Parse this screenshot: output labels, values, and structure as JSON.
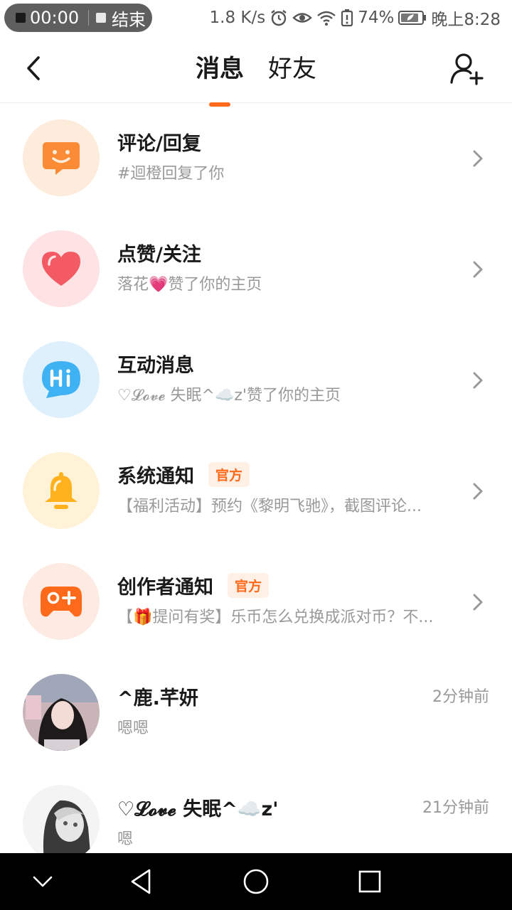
{
  "status_bar": {
    "record_time": "00:00",
    "record_stop_label": "结束",
    "net_speed": "1.8 K/s",
    "battery": "74%",
    "time": "晚上8:28"
  },
  "header": {
    "tabs": [
      {
        "label": "消息"
      },
      {
        "label": "好友"
      }
    ]
  },
  "notifications": [
    {
      "title": "评论/回复",
      "subtitle": "#迴橙回复了你",
      "icon": "smile-chat-icon",
      "bg": "#fdebdc",
      "fg": "#fb8c35"
    },
    {
      "title": "点赞/关注",
      "subtitle": "落花💗赞了你的主页",
      "icon": "heart-icon",
      "bg": "#fde3e3",
      "fg": "#f35a63"
    },
    {
      "title": "互动消息",
      "subtitle": "♡𝓛𝓸𝓿𝓮 失眠^☁️z'赞了你的主页",
      "icon": "hi-chat-icon",
      "bg": "#dff0fd",
      "fg": "#3fb2f4"
    },
    {
      "title": "系统通知",
      "badge": "官方",
      "subtitle": "【福利活动】预约《黎明飞驰》，截图评论...",
      "icon": "bell-icon",
      "bg": "#fff2d6",
      "fg": "#ffb21d"
    },
    {
      "title": "创作者通知",
      "badge": "官方",
      "subtitle": "【🎁提问有奖】乐币怎么兑换成派对币？不...",
      "icon": "gamepad-icon",
      "bg": "#fdebe3",
      "fg": "#ff6a1a"
    }
  ],
  "conversations": [
    {
      "name": "^鹿.芊妍",
      "last_message": "嗯嗯",
      "time": "2分钟前"
    },
    {
      "name": "♡𝓛𝓸𝓿𝓮 失眠^☁️z'",
      "last_message": "嗯",
      "time": "21分钟前"
    }
  ],
  "colors": {
    "accent": "#ff6a1a",
    "subtitle": "#999999"
  }
}
